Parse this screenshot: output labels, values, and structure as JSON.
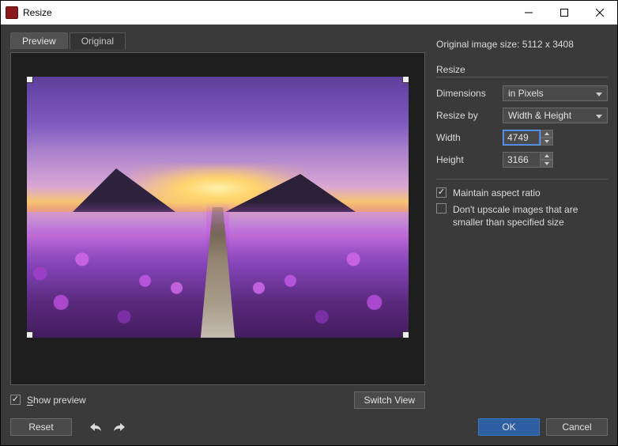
{
  "window": {
    "title": "Resize"
  },
  "tabs": {
    "preview": "Preview",
    "original": "Original"
  },
  "info": {
    "original_label": "Original image size:",
    "original_value": "5112 x 3408"
  },
  "section": {
    "resize": "Resize"
  },
  "form": {
    "dimensions_label": "Dimensions",
    "dimensions_value": "in Pixels",
    "resizeby_label": "Resize by",
    "resizeby_value": "Width & Height",
    "width_label": "Width",
    "width_value": "4749",
    "height_label": "Height",
    "height_value": "3166"
  },
  "checks": {
    "maintain_ratio": "Maintain aspect ratio",
    "dont_upscale": "Don't upscale images that are smaller than specified size"
  },
  "controls": {
    "show_preview_prefix": "S",
    "show_preview_rest": "how preview",
    "switch_view": "Switch View",
    "reset": "Reset",
    "ok": "OK",
    "cancel": "Cancel"
  }
}
